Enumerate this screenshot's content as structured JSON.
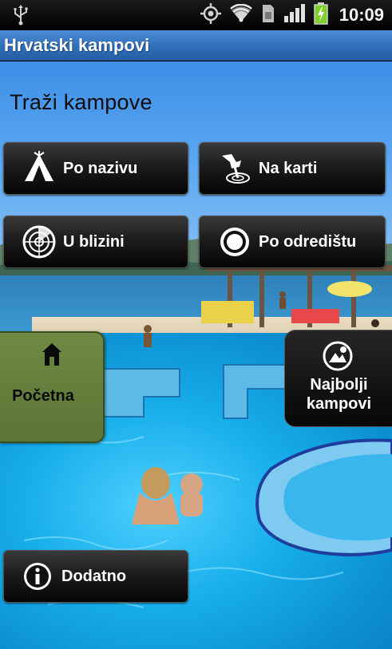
{
  "status_bar": {
    "time": "10:09",
    "icons": [
      "usb-icon",
      "gps-icon",
      "wifi-icon",
      "sim-icon",
      "signal-icon",
      "battery-charging-icon"
    ]
  },
  "app": {
    "title": "Hrvatski kampovi"
  },
  "main": {
    "heading": "Traži kampove",
    "search_buttons": [
      {
        "label": "Po nazivu",
        "icon": "tent-icon"
      },
      {
        "label": "Na karti",
        "icon": "map-pin-icon"
      },
      {
        "label": "U blizini",
        "icon": "radar-icon"
      },
      {
        "label": "Po odredištu",
        "icon": "target-icon"
      }
    ]
  },
  "side_tabs": {
    "home": {
      "label": "Početna",
      "icon": "home-icon"
    },
    "best": {
      "label_line1": "Najbolji",
      "label_line2": "kampovi",
      "icon": "best-camps-icon"
    }
  },
  "footer": {
    "more": {
      "label": "Dodatno",
      "icon": "info-icon"
    }
  },
  "colors": {
    "title_bar": "#2f6fb8",
    "home_tab": "#667f3c",
    "button_bg": "#1c1c1c"
  }
}
